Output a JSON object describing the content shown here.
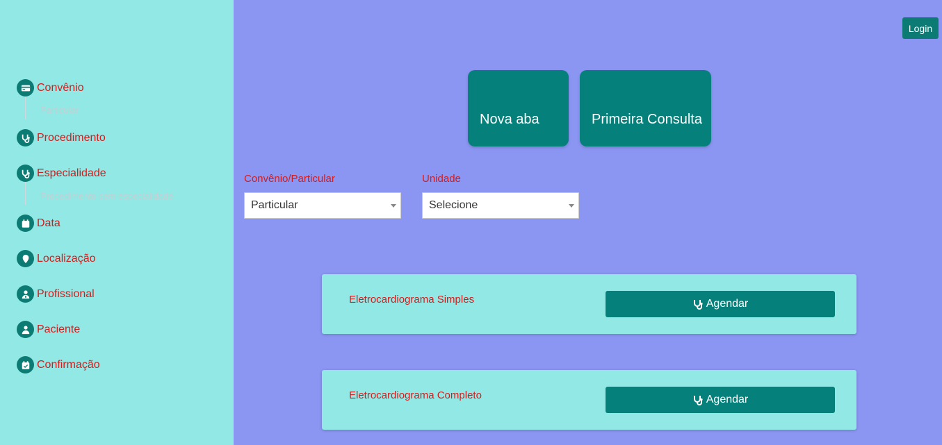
{
  "sidebar": {
    "steps": [
      {
        "label": "Convênio",
        "icon": "credit-card-icon"
      },
      {
        "label": "Procedimento",
        "icon": "stethoscope-icon"
      },
      {
        "label": "Especialidade",
        "icon": "stethoscope-icon"
      },
      {
        "label": "Data",
        "icon": "calendar-icon"
      },
      {
        "label": "Localização",
        "icon": "map-pin-icon"
      },
      {
        "label": "Profissional",
        "icon": "doctor-icon"
      },
      {
        "label": "Paciente",
        "icon": "user-icon"
      },
      {
        "label": "Confirmação",
        "icon": "calendar-check-icon"
      }
    ],
    "convenio_value": "Particular",
    "especialidade_value": "Procedimento sem especialidade"
  },
  "header": {
    "login_label": "Login"
  },
  "tiles": {
    "new_tab": "Nova aba",
    "first_consult": "Primeira Consulta"
  },
  "filters": {
    "convenio_label": "Convênio/Particular",
    "convenio_value": "Particular",
    "unidade_label": "Unidade",
    "unidade_value": "Selecione"
  },
  "procedures": [
    {
      "name": "Eletrocardiograma Simples",
      "button": "Agendar"
    },
    {
      "name": "Eletrocardiograma Completo",
      "button": "Agendar"
    }
  ],
  "colors": {
    "sidebar_bg": "#92e8e4",
    "main_bg": "#8a96f2",
    "primary": "#05807a",
    "label_red": "#d41c1c"
  }
}
